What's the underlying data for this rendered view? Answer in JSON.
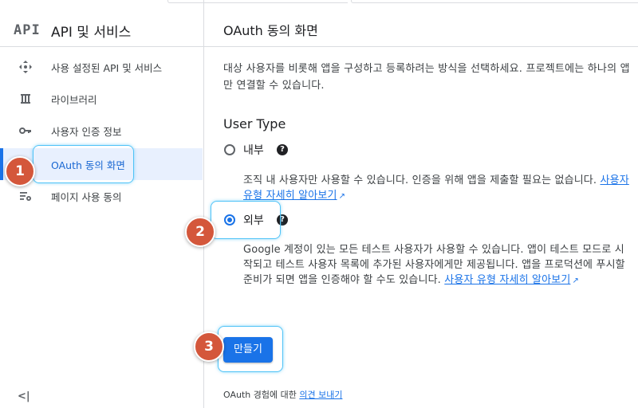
{
  "sidebar": {
    "logo": "API",
    "title": "API 및 서비스",
    "items": [
      {
        "label": "사용 설정된 API 및 서비스",
        "icon": "diamond-arrows-icon"
      },
      {
        "label": "라이브러리",
        "icon": "library-icon"
      },
      {
        "label": "사용자 인증 정보",
        "icon": "key-icon"
      },
      {
        "label": "OAuth 동의 화면",
        "icon": "consent-icon",
        "active": true
      },
      {
        "label": "페이지 사용 동의",
        "icon": "settings-list-icon"
      }
    ],
    "collapse_label": "<|"
  },
  "main": {
    "title": "OAuth 동의 화면",
    "description": "대상 사용자를 비롯해 앱을 구성하고 등록하려는 방식을 선택하세요. 프로젝트에는 하나의 앱만 연결할 수 있습니다.",
    "user_type_title": "User Type",
    "options": [
      {
        "label": "내부",
        "checked": false,
        "description": "조직 내 사용자만 사용할 수 있습니다. 인증을 위해 앱을 제출할 필요는 없습니다.",
        "link": "사용자 유형 자세히 알아보기"
      },
      {
        "label": "외부",
        "checked": true,
        "description": "Google 계정이 있는 모든 테스트 사용자가 사용할 수 있습니다. 앱이 테스트 모드로 시작되고 테스트 사용자 목록에 추가된 사용자에게만 제공됩니다. 앱을 프로덕션에 푸시할 준비가 되면 앱을 인증해야 할 수도 있습니다.",
        "link": "사용자 유형 자세히 알아보기"
      }
    ],
    "create_label": "만들기",
    "feedback_prefix": "OAuth 경험에 대한",
    "feedback_link": "의견 보내기"
  },
  "annotations": {
    "markers": [
      "1",
      "2",
      "3"
    ],
    "marker_color": "#d4573b",
    "highlight_color": "#4fc3f7"
  },
  "colors": {
    "accent": "#1a73e8",
    "active_bg": "#e8f0fe"
  }
}
